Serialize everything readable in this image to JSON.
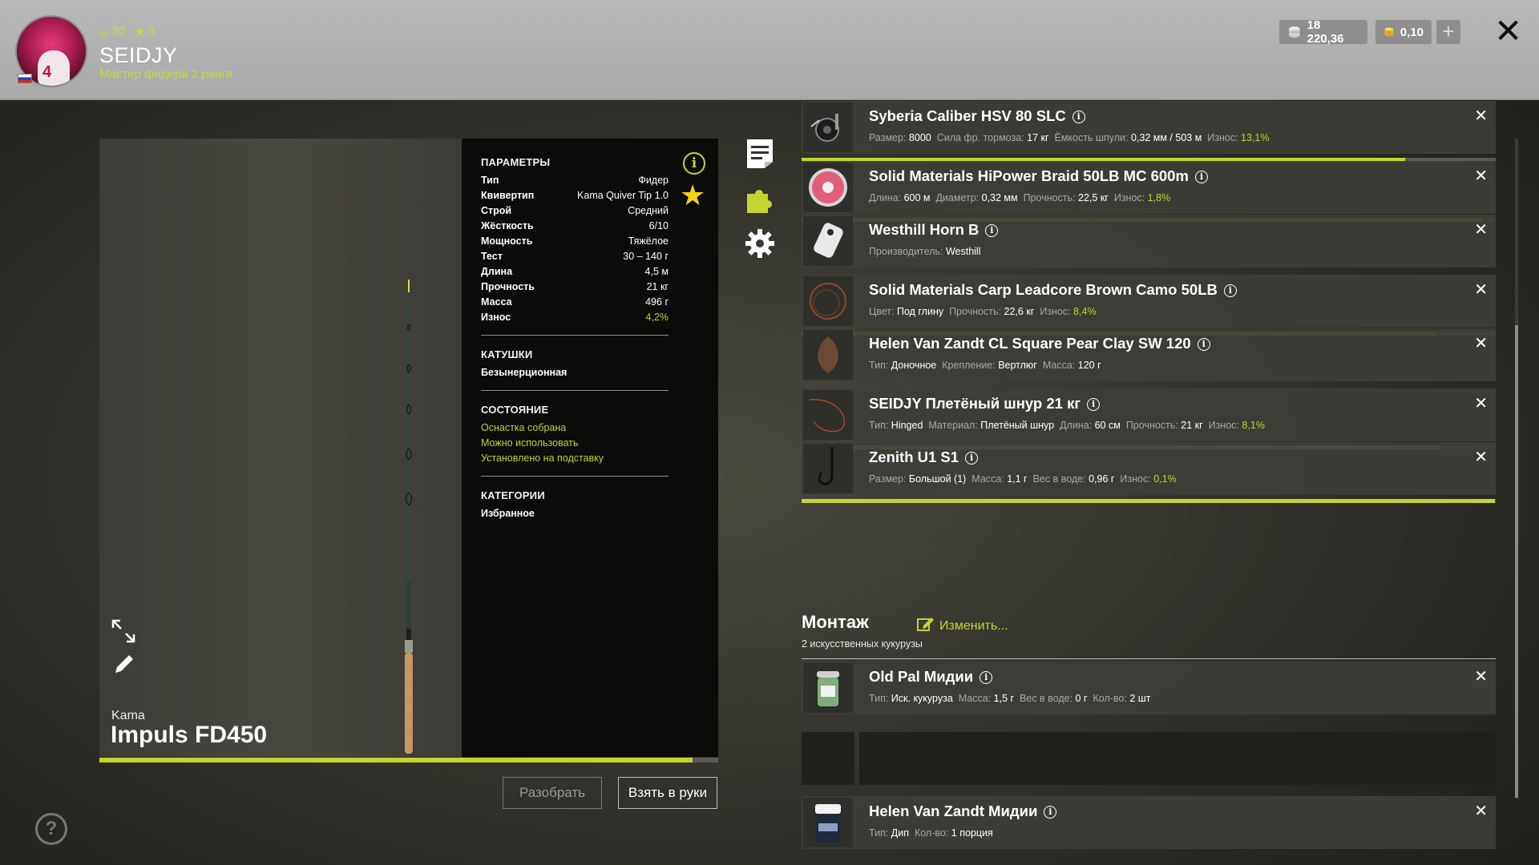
{
  "header": {
    "level": "30",
    "stars": "9",
    "username": "SEIDJY",
    "rank": "Мастер фидера 2 ранга",
    "silver": "18 220,36",
    "gold": "0,10",
    "avatar_number": "4"
  },
  "rod": {
    "brand": "Kama",
    "model": "Impuls FD450",
    "durability_percent": 95.8
  },
  "params": {
    "title": "ПАРАМЕТРЫ",
    "rows": [
      {
        "label": "Тип",
        "value": "Фидер"
      },
      {
        "label": "Квивертип",
        "value": "Kama Quiver Tip 1.0"
      },
      {
        "label": "Строй",
        "value": "Средний"
      },
      {
        "label": "Жёсткость",
        "value": "6/10"
      },
      {
        "label": "Мощность",
        "value": "Тяжёлое"
      },
      {
        "label": "Тест",
        "value": "30 – 140 г"
      },
      {
        "label": "Длина",
        "value": "4,5 м"
      },
      {
        "label": "Прочность",
        "value": "21 кг"
      },
      {
        "label": "Масса",
        "value": "496 г"
      },
      {
        "label": "Износ",
        "value": "4,2%"
      }
    ],
    "reels_title": "КАТУШКИ",
    "reels_value": "Безынерционная",
    "state_title": "СОСТОЯНИЕ",
    "state_items": [
      "Оснастка собрана",
      "Можно использовать",
      "Установлено на подставку"
    ],
    "categories_title": "КАТЕГОРИИ",
    "categories_value": "Избранное"
  },
  "buttons": {
    "disassemble": "Разобрать",
    "take": "Взять в руки"
  },
  "items": [
    {
      "title": "Syberia Caliber HSV 80 SLC",
      "desc": [
        {
          "k": "Размер:",
          "v": "8000"
        },
        {
          "k": "Сила фр. тормоза:",
          "v": "17 кг"
        },
        {
          "k": "Ёмкость шпули:",
          "v": "0,32 мм / 503 м"
        },
        {
          "k": "Износ:",
          "v": "13,1%",
          "green": true
        }
      ],
      "wear": 86.9
    },
    {
      "title": "Solid Materials HiPower Braid 50LB MC 600m",
      "desc": [
        {
          "k": "Длина:",
          "v": "600 м"
        },
        {
          "k": "Диаметр:",
          "v": "0,32 мм"
        },
        {
          "k": "Прочность:",
          "v": "22,5 кг"
        },
        {
          "k": "Износ:",
          "v": "1,8%",
          "green": true
        }
      ],
      "wear": 98.2
    },
    {
      "title": "Westhill Horn B",
      "desc": [
        {
          "k": "Производитель:",
          "v": "Westhill"
        }
      ],
      "wear": null
    },
    {
      "title": "Solid Materials Carp Leadcore Brown Camo 50LB",
      "desc": [
        {
          "k": "Цвет:",
          "v": "Под глину"
        },
        {
          "k": "Прочность:",
          "v": "22,6 кг"
        },
        {
          "k": "Износ:",
          "v": "8,4%",
          "green": true
        }
      ],
      "wear": 91.6
    },
    {
      "title": "Helen Van Zandt CL Square Pear Clay SW 120",
      "desc": [
        {
          "k": "Тип:",
          "v": "Доночное"
        },
        {
          "k": "Крепление:",
          "v": "Вертлюг"
        },
        {
          "k": "Масса:",
          "v": "120 г"
        }
      ],
      "wear": null
    },
    {
      "title": "SEIDJY Плетёный шнур 21 кг",
      "desc": [
        {
          "k": "Тип:",
          "v": "Hinged"
        },
        {
          "k": "Материал:",
          "v": "Плетёный шнур"
        },
        {
          "k": "Длина:",
          "v": "60 см"
        },
        {
          "k": "Прочность:",
          "v": "21 кг"
        },
        {
          "k": "Износ:",
          "v": "8,1%",
          "green": true
        }
      ],
      "wear": 91.9
    },
    {
      "title": "Zenith U1 S1",
      "desc": [
        {
          "k": "Размер:",
          "v": "Большой (1)"
        },
        {
          "k": "Масса:",
          "v": "1,1 г"
        },
        {
          "k": "Вес в воде:",
          "v": "0,96 г"
        },
        {
          "k": "Износ:",
          "v": "0,1%",
          "green": true
        }
      ],
      "wear": 99.9
    }
  ],
  "montage": {
    "title": "Монтаж",
    "edit": "Изменить...",
    "subtitle": "2 искусственных кукурузы"
  },
  "baits": [
    {
      "title": "Old Pal Мидии",
      "desc": [
        {
          "k": "Тип:",
          "v": "Иск. кукуруза"
        },
        {
          "k": "Масса:",
          "v": "1,5 г"
        },
        {
          "k": "Вес в воде:",
          "v": "0 г"
        },
        {
          "k": "Кол-во:",
          "v": "2 шт"
        }
      ]
    },
    {
      "title": "Helen Van Zandt Мидии",
      "desc": [
        {
          "k": "Тип:",
          "v": "Дип"
        },
        {
          "k": "Кол-во:",
          "v": "1 порция"
        }
      ]
    }
  ],
  "colors": {
    "accent": "#c3d42f",
    "star": "#f6d21a"
  }
}
